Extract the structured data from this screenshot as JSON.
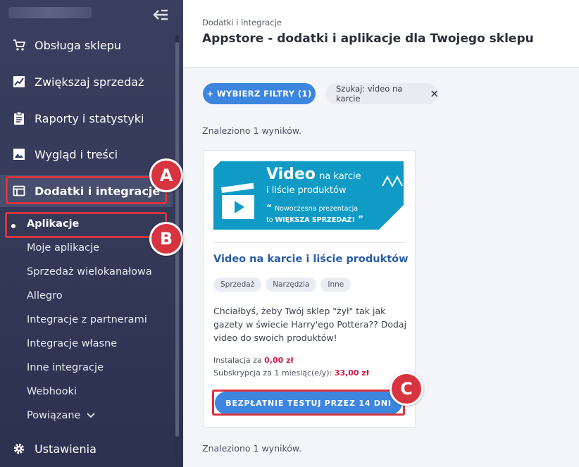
{
  "sidebar": {
    "nav": [
      {
        "label": "Obsługa sklepu",
        "icon": "cart-icon"
      },
      {
        "label": "Zwiększaj sprzedaż",
        "icon": "chart-icon"
      },
      {
        "label": "Raporty i statystyki",
        "icon": "clipboard-icon"
      },
      {
        "label": "Wygląd i treści",
        "icon": "image-icon"
      },
      {
        "label": "Dodatki i integracje",
        "icon": "window-icon"
      }
    ],
    "sub": [
      "Aplikacje",
      "Moje aplikacje",
      "Sprzedaż wielokanałowa",
      "Allegro",
      "Integracje z partnerami",
      "Integracje własne",
      "Inne integracje",
      "Webhooki",
      "Powiązane"
    ],
    "settings": "Ustawienia"
  },
  "header": {
    "breadcrumb": "Dodatki i integracje",
    "title": "Appstore - dodatki i aplikacje dla Twojego sklepu"
  },
  "filters": {
    "button": "+ WYBIERZ FILTRY (1)",
    "chip": "Szukaj: video na karcie"
  },
  "results": {
    "count_top": "Znaleziono 1 wyników.",
    "count_bottom": "Znaleziono 1 wyników."
  },
  "app": {
    "banner": {
      "title_big": "Video",
      "title_rest": "na karcie",
      "title_line2": "i liście produktów",
      "quote_line1": "Nowoczesna prezentacja",
      "quote_line2_pre": "to ",
      "quote_line2_bold": "WIĘKSZA SPRZEDAŻ!"
    },
    "title": "Video na karcie i liście produktów",
    "tags": [
      "Sprzedaż",
      "Narzędzia",
      "Inne"
    ],
    "description": "Chciałbyś, żeby Twój sklep \"żył\" tak jak gazety w świecie Harry'ego Pottera?? Dodaj video do swoich produktów!",
    "install_label": "Instalacja za",
    "install_price": "0,00 zł",
    "sub_label": "Subskrypcja za 1 miesiąc(e/y):",
    "sub_price": "33,00 zł",
    "cta": "BEZPŁATNIE TESTUJ PRZEZ 14 DNI"
  },
  "annotations": [
    "A",
    "B",
    "C"
  ],
  "colors": {
    "sidebar": "#363b5a",
    "accent": "#3d86e0",
    "highlight": "#d8343f",
    "price": "#d01e48",
    "banner": "#0f9bc6"
  }
}
